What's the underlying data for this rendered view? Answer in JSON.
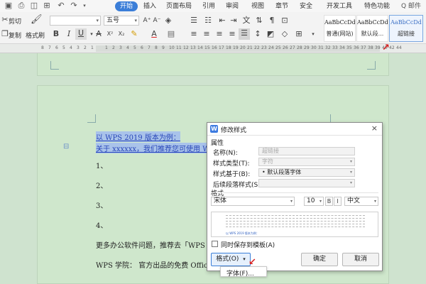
{
  "menu": {
    "tabs": [
      "开始",
      "插入",
      "页面布局",
      "引用",
      "审阅",
      "视图",
      "章节",
      "安全",
      "开发工具",
      "特色功能"
    ],
    "active_tab": "开始",
    "search_label": "Q 邮件"
  },
  "toolbar": {
    "cut_label": "剪切",
    "copy_label": "复制",
    "format_painter_label": "格式刷",
    "font_size": "五号",
    "styles": [
      {
        "preview": "AaBbCcDd",
        "name": "普通(网站)"
      },
      {
        "preview": "AaBbCcDd",
        "name": "默认段..."
      },
      {
        "preview": "AaBbCcDd",
        "name": "超链接"
      }
    ]
  },
  "ruler": {
    "numbers": [
      "8",
      "7",
      "6",
      "5",
      "4",
      "3",
      "2",
      "1",
      "",
      "1",
      "2",
      "3",
      "4",
      "5",
      "6",
      "7",
      "8",
      "9",
      "10",
      "11",
      "12",
      "13",
      "14",
      "15",
      "16",
      "17",
      "18",
      "19",
      "20",
      "21",
      "22",
      "23",
      "24",
      "25",
      "26",
      "27",
      "28",
      "29",
      "30",
      "31",
      "32",
      "33",
      "34",
      "35",
      "36",
      "37",
      "38",
      "39",
      "40",
      "42",
      "44"
    ]
  },
  "document": {
    "line1": "以 WPS 2019 版本为例：",
    "line2": "关于 xxxxxx，我们推荐您可使用 WPS2",
    "items": [
      "1、",
      "2、",
      "3、",
      "4、"
    ],
    "line_more": "更多办公软件问题，推荐去「WPS 学",
    "line_academy": "WPS 学院：  官方出品的免费 Office 学"
  },
  "dialog": {
    "title": "修改样式",
    "close": "×",
    "section_properties": "属性",
    "name_label": "名称(N):",
    "name_value": "超链接",
    "type_label": "样式类型(T):",
    "type_value": "字符",
    "based_label": "样式基于(B):",
    "based_value": "• 默认段落字体",
    "next_label": "后续段落样式(S):",
    "next_value": "",
    "section_format": "格式",
    "font_value": "宋体",
    "size_value": "10",
    "lang_value": "中文",
    "preview_text": "以 WPS 2019 版本为例：",
    "template_checkbox": "同时保存到模板(A)",
    "format_button": "格式(O)",
    "ok_button": "确定",
    "cancel_button": "取消"
  },
  "format_menu": {
    "font_item": "字体(F)..."
  }
}
